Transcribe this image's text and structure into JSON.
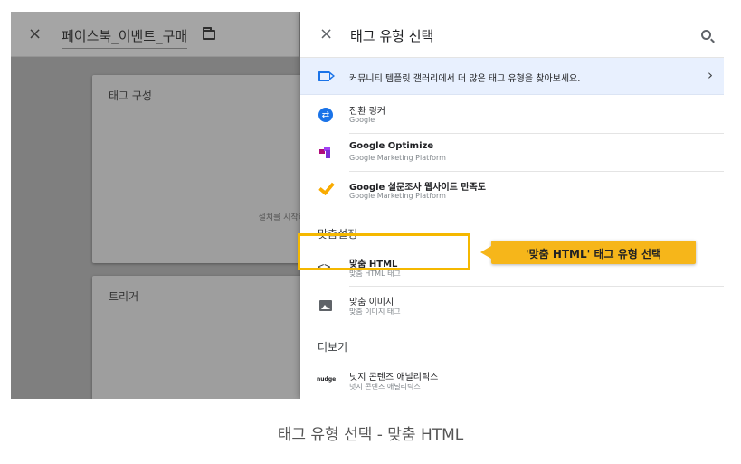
{
  "left": {
    "close_glyph": "×",
    "tag_name": "페이스북_이벤트_구매",
    "config_card_title": "태그 구성",
    "config_card_hint": "설치를 시작하",
    "trigger_card_title": "트리거"
  },
  "panel": {
    "close_glyph": "×",
    "title": "태그 유형 선택",
    "gallery_text": "커뮤니티 템플릿 갤러리에서 더 많은 태그 유형을 찾아보세요.",
    "gallery_chevron": "›",
    "featured": [
      {
        "name": "전환 링커",
        "sub": "Google",
        "icon": "conversion-linker-icon"
      },
      {
        "name": "Google Optimize",
        "sub": "Google Marketing Platform",
        "icon": "optimize-icon"
      },
      {
        "name": "Google 설문조사 웹사이트 만족도",
        "sub": "Google Marketing Platform",
        "icon": "survey-check-icon"
      }
    ],
    "custom_section": "맞춤설정",
    "custom": [
      {
        "name": "맞춤 HTML",
        "sub": "맞춤 HTML 태그",
        "icon_glyph": "<>"
      },
      {
        "name": "맞춤 이미지",
        "sub": "맞춤 이미지 태그"
      }
    ],
    "more_section": "더보기",
    "more": [
      {
        "name": "넛지 콘텐즈 애널리틱스",
        "sub": "넛지 콘텐즈 애널리틱스",
        "icon_text": "nudge"
      }
    ]
  },
  "callout": {
    "text": "'맞춤 HTML' 태그 유형 선택"
  },
  "caption": "태그 유형 선택 - 맞춤 HTML",
  "colors": {
    "accent_blue": "#1a73e8",
    "highlight": "#f5b800",
    "callout_bg": "#f6b61a"
  }
}
